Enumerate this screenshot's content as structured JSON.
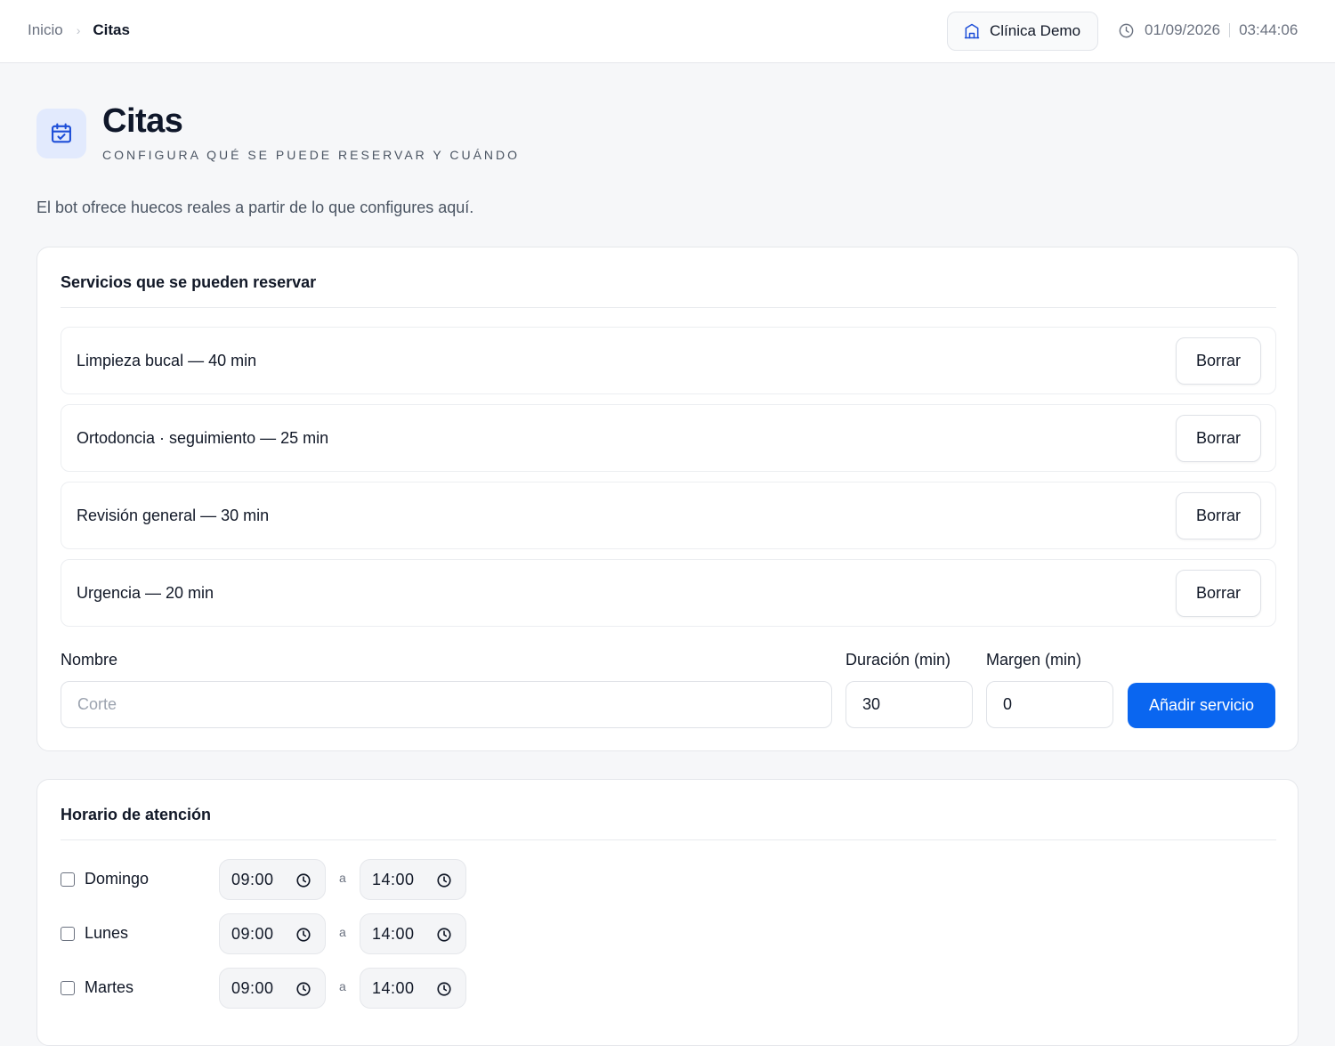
{
  "breadcrumb": {
    "home": "Inicio",
    "current": "Citas"
  },
  "org": {
    "name": "Clínica Demo",
    "icon": "building-icon"
  },
  "clock": {
    "date": "01/09/2026",
    "time": "03:44:06",
    "icon": "clock-icon"
  },
  "header": {
    "icon": "calendar-check-icon",
    "title": "Citas",
    "subtitle": "Configura qué se puede reservar y cuándo",
    "description": "El bot ofrece huecos reales a partir de lo que configures aquí."
  },
  "services": {
    "title": "Servicios que se pueden reservar",
    "items": [
      {
        "label": "Limpieza bucal — 40 min",
        "action": "Borrar"
      },
      {
        "label": "Ortodoncia · seguimiento — 25 min",
        "action": "Borrar"
      },
      {
        "label": "Revisión general — 30 min",
        "action": "Borrar"
      },
      {
        "label": "Urgencia — 20 min",
        "action": "Borrar"
      }
    ],
    "form": {
      "name_label": "Nombre",
      "name_placeholder": "Corte",
      "name_value": "",
      "duration_label": "Duración (min)",
      "duration_value": "30",
      "margin_label": "Margen (min)",
      "margin_value": "0",
      "submit": "Añadir servicio"
    }
  },
  "schedule": {
    "title": "Horario de atención",
    "separator": "a",
    "days": [
      {
        "name": "Domingo",
        "checked": false,
        "from": "09:00",
        "to": "14:00"
      },
      {
        "name": "Lunes",
        "checked": false,
        "from": "09:00",
        "to": "14:00"
      },
      {
        "name": "Martes",
        "checked": false,
        "from": "09:00",
        "to": "14:00"
      }
    ]
  },
  "colors": {
    "accent": "#0a66f0",
    "icon_bg": "#e2eafd",
    "page_bg": "#f6f7f9"
  }
}
